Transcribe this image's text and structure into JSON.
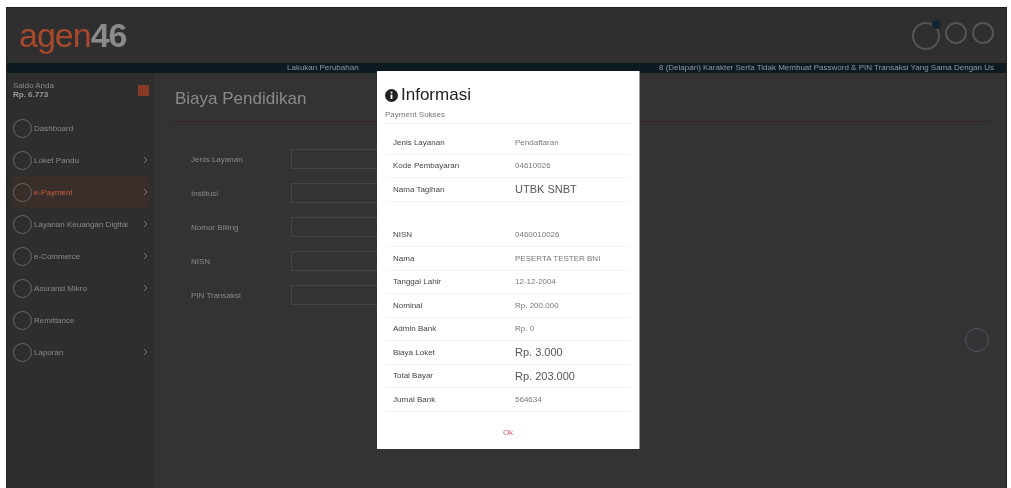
{
  "logo": {
    "brand": "agen",
    "number": "46"
  },
  "ticker": {
    "left": "Lakukan Perubahan",
    "right": "8 (Delapan) Karakter Serta Tidak Membuat Password & PIN Transaksi Yang Sama Dengan Us"
  },
  "sidebar": {
    "balance_label": "Saldo Anda",
    "balance": "Rp. 6.773",
    "items": [
      {
        "label": "Dashboard",
        "selected": false,
        "has_submenu": false
      },
      {
        "label": "Loket Pandu",
        "selected": false,
        "has_submenu": true
      },
      {
        "label": "e-Payment",
        "selected": true,
        "has_submenu": true
      },
      {
        "label": "Layanan Keuangan Digital",
        "selected": false,
        "has_submenu": true
      },
      {
        "label": "e-Commerce",
        "selected": false,
        "has_submenu": true
      },
      {
        "label": "Asuransi Mikro",
        "selected": false,
        "has_submenu": true
      },
      {
        "label": "Remittance",
        "selected": false,
        "has_submenu": false
      },
      {
        "label": "Laporan",
        "selected": false,
        "has_submenu": true
      }
    ]
  },
  "page_title": "Biaya Pendidikan",
  "form": [
    {
      "label": "Jenis Layanan"
    },
    {
      "label": "Institusi"
    },
    {
      "label": "Nomor Billing"
    },
    {
      "label": "NISN"
    },
    {
      "label": "PIN Transaksi"
    }
  ],
  "modal": {
    "title": "Informasi",
    "subtitle": "Payment Sukses",
    "sections": [
      {
        "rows": [
          {
            "label": "Jenis Layanan",
            "value": "Pendaftaran",
            "kind": "normal"
          },
          {
            "label": "Kode Pembayaran",
            "value": "04610026",
            "kind": "normal"
          },
          {
            "label": "Nama Tagihan",
            "value": "UTBK SNBT",
            "kind": "large"
          }
        ]
      },
      {
        "rows": [
          {
            "label": "NISN",
            "value": "0460010026",
            "kind": "normal"
          },
          {
            "label": "Nama",
            "value": "PESERTA TESTER BNI",
            "kind": "normal"
          },
          {
            "label": "Tanggal Lahir",
            "value": "12-12-2004",
            "kind": "normal"
          },
          {
            "label": "Nominal",
            "value": "Rp. 200.000",
            "kind": "normal"
          },
          {
            "label": "Admin Bank",
            "value": "Rp. 0",
            "kind": "normal"
          },
          {
            "label": "Biaya Loket",
            "value": "Rp. 3.000",
            "kind": "large"
          },
          {
            "label": "Total Bayar",
            "value": "Rp. 203.000",
            "kind": "large"
          },
          {
            "label": "Jurnal Bank",
            "value": "564634",
            "kind": "normal"
          }
        ]
      }
    ],
    "button": "Ok"
  }
}
